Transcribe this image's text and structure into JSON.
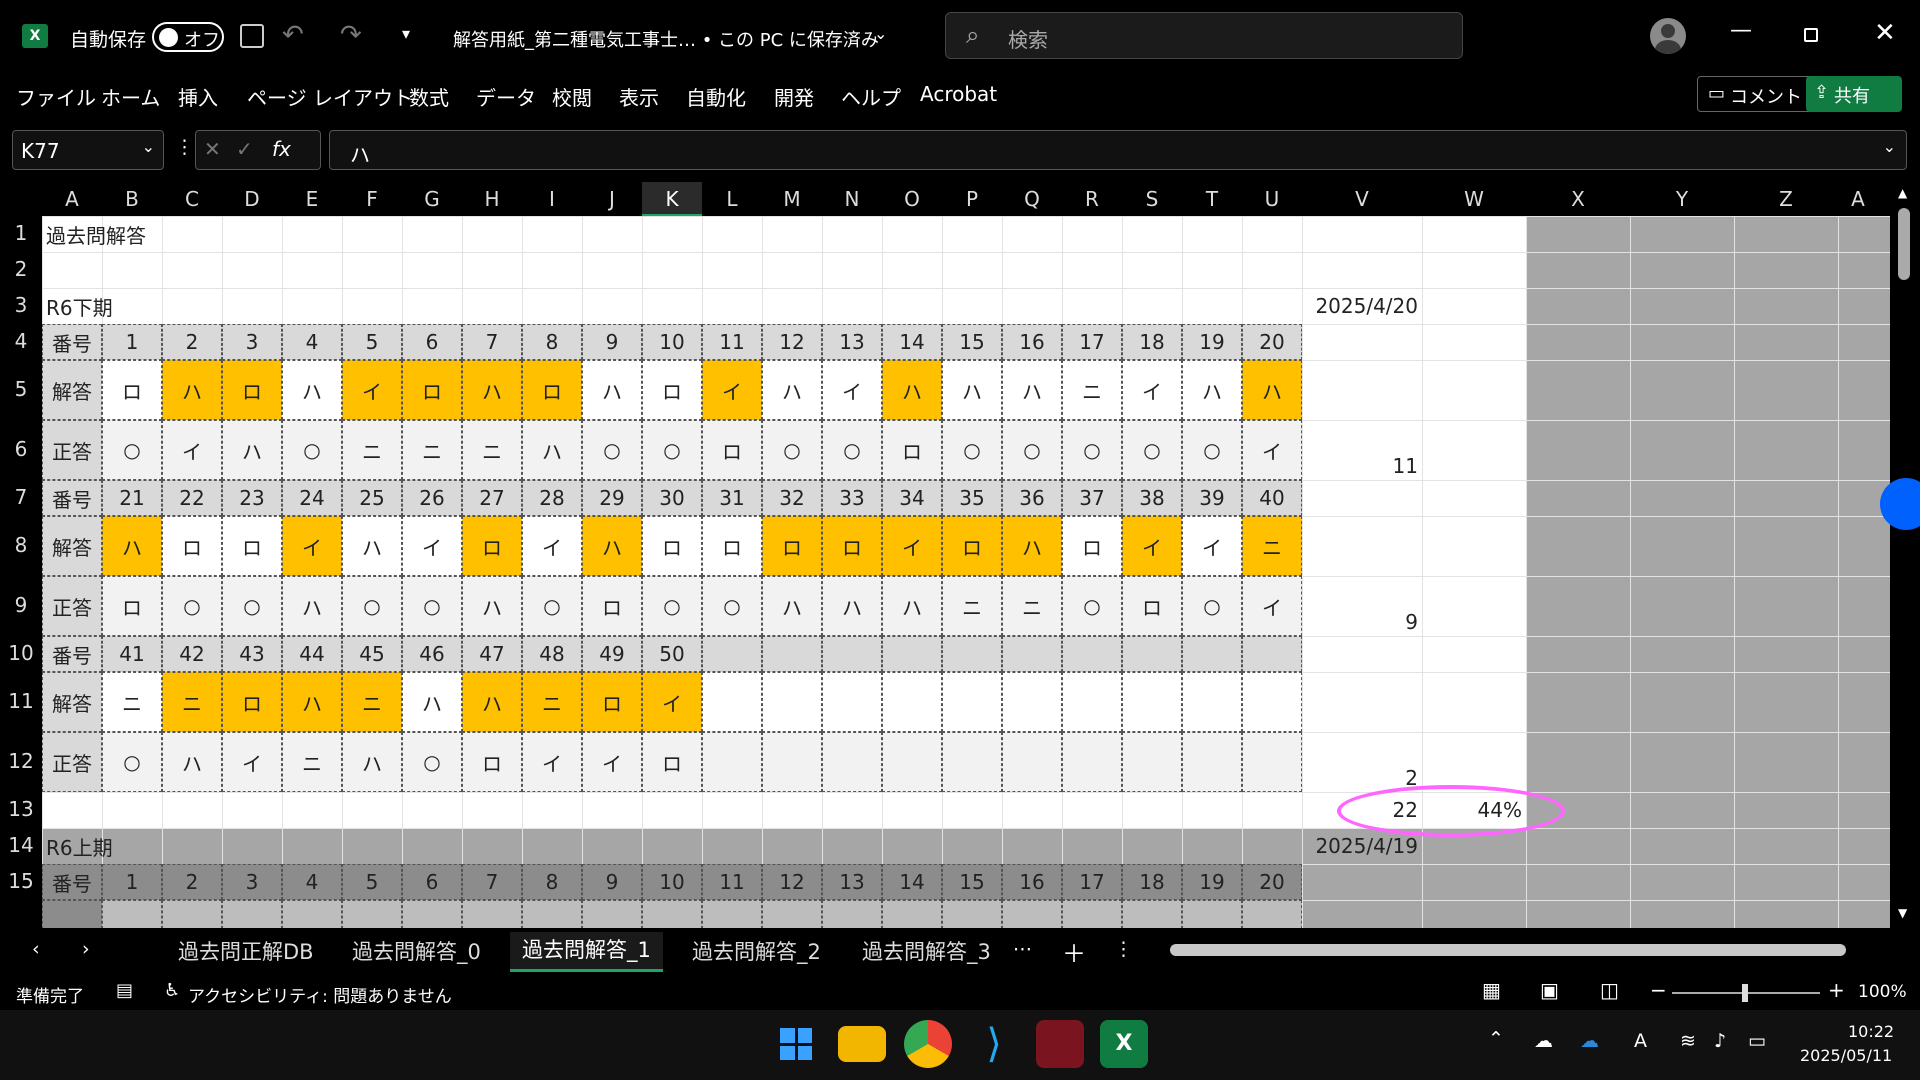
{
  "titlebar": {
    "autosave_label": "自動保存",
    "autosave_state": "オフ",
    "doc_title": "解答用紙_第二種電気工事士… • この PC に保存済み",
    "search_placeholder": "検索"
  },
  "menu": [
    "ファイル",
    "ホーム",
    "挿入",
    "ページ レイアウト",
    "数式",
    "データ",
    "校閲",
    "表示",
    "自動化",
    "開発",
    "ヘルプ",
    "Acrobat"
  ],
  "buttons": {
    "comment": "コメント",
    "share": "共有"
  },
  "formula_bar": {
    "name_box": "K77",
    "fx": "fx",
    "value": "ハ"
  },
  "columns": [
    "A",
    "B",
    "C",
    "D",
    "E",
    "F",
    "G",
    "H",
    "I",
    "J",
    "K",
    "L",
    "M",
    "N",
    "O",
    "P",
    "Q",
    "R",
    "S",
    "T",
    "U",
    "V",
    "W",
    "X",
    "Y",
    "Z",
    "A"
  ],
  "rows": [
    "1",
    "2",
    "3",
    "4",
    "5",
    "6",
    "7",
    "8",
    "9",
    "10",
    "11",
    "12",
    "13",
    "14",
    "15"
  ],
  "sheet": {
    "title": "過去問解答",
    "section1": {
      "name": "R6下期",
      "date": "2025/4/20"
    },
    "section2": {
      "name": "R6上期",
      "date": "2025/4/19"
    },
    "labels": {
      "num": "番号",
      "answer": "解答",
      "correct": "正答"
    },
    "block1": {
      "nums": [
        "1",
        "2",
        "3",
        "4",
        "5",
        "6",
        "7",
        "8",
        "9",
        "10",
        "11",
        "12",
        "13",
        "14",
        "15",
        "16",
        "17",
        "18",
        "19",
        "20"
      ],
      "answers": [
        "ロ",
        "ハ",
        "ロ",
        "ハ",
        "イ",
        "ロ",
        "ハ",
        "ロ",
        "ハ",
        "ロ",
        "イ",
        "ハ",
        "イ",
        "ハ",
        "ハ",
        "ハ",
        "ニ",
        "イ",
        "ハ",
        "ハ"
      ],
      "correct": [
        "○",
        "イ",
        "ハ",
        "○",
        "ニ",
        "ニ",
        "ニ",
        "ハ",
        "○",
        "○",
        "ロ",
        "○",
        "○",
        "ロ",
        "○",
        "○",
        "○",
        "○",
        "○",
        "イ"
      ],
      "wrong": [
        false,
        true,
        true,
        false,
        true,
        true,
        true,
        true,
        false,
        false,
        true,
        false,
        false,
        true,
        false,
        false,
        false,
        false,
        false,
        true
      ],
      "score": "11"
    },
    "block2": {
      "nums": [
        "21",
        "22",
        "23",
        "24",
        "25",
        "26",
        "27",
        "28",
        "29",
        "30",
        "31",
        "32",
        "33",
        "34",
        "35",
        "36",
        "37",
        "38",
        "39",
        "40"
      ],
      "answers": [
        "ハ",
        "ロ",
        "ロ",
        "イ",
        "ハ",
        "イ",
        "ロ",
        "イ",
        "ハ",
        "ロ",
        "ロ",
        "ロ",
        "ロ",
        "イ",
        "ロ",
        "ハ",
        "ロ",
        "イ",
        "イ",
        "ニ"
      ],
      "correct": [
        "ロ",
        "○",
        "○",
        "ハ",
        "○",
        "○",
        "ハ",
        "○",
        "ロ",
        "○",
        "○",
        "ハ",
        "ハ",
        "ハ",
        "ニ",
        "ニ",
        "○",
        "ロ",
        "○",
        "イ"
      ],
      "wrong": [
        true,
        false,
        false,
        true,
        false,
        false,
        true,
        false,
        true,
        false,
        false,
        true,
        true,
        true,
        true,
        true,
        false,
        true,
        false,
        true
      ],
      "score": "9"
    },
    "block3": {
      "nums": [
        "41",
        "42",
        "43",
        "44",
        "45",
        "46",
        "47",
        "48",
        "49",
        "50"
      ],
      "answers": [
        "ニ",
        "ニ",
        "ロ",
        "ハ",
        "ニ",
        "ハ",
        "ハ",
        "ニ",
        "ロ",
        "イ"
      ],
      "correct": [
        "○",
        "ハ",
        "イ",
        "ニ",
        "ハ",
        "○",
        "ロ",
        "イ",
        "イ",
        "ロ"
      ],
      "wrong": [
        false,
        true,
        true,
        true,
        true,
        false,
        true,
        true,
        true,
        true
      ],
      "score": "2"
    },
    "total": "22",
    "percent": "44%",
    "block4_nums": [
      "1",
      "2",
      "3",
      "4",
      "5",
      "6",
      "7",
      "8",
      "9",
      "10",
      "11",
      "12",
      "13",
      "14",
      "15",
      "16",
      "17",
      "18",
      "19",
      "20"
    ]
  },
  "tabs": [
    "過去問正解DB",
    "過去問解答_0",
    "過去問解答_1",
    "過去問解答_2",
    "過去問解答_3"
  ],
  "active_tab": "過去問解答_1",
  "status": {
    "ready": "準備完了",
    "accessibility": "アクセシビリティ: 問題ありません",
    "zoom": "100%"
  },
  "clock": {
    "time": "10:22",
    "date": "2025/05/11"
  },
  "colors": {
    "orange": "#ffc000",
    "accent": "#21a366",
    "circle": "#ff66ff"
  }
}
